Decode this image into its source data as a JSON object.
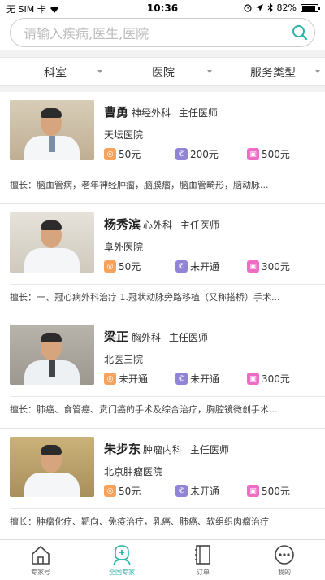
{
  "status_bar": {
    "carrier": "无 SIM 卡",
    "time": "10:36",
    "battery": "82%"
  },
  "search": {
    "placeholder": "请输入疾病,医生,医院"
  },
  "filters": [
    {
      "label": "科室"
    },
    {
      "label": "医院"
    },
    {
      "label": "服务类型"
    }
  ],
  "doctors": [
    {
      "name": "曹勇",
      "dept": "神经外科",
      "title": "主任医师",
      "hospital": "天坛医院",
      "prices": [
        "50元",
        "200元",
        "500元"
      ],
      "specialty": "擅长：脑血管病，老年神经肿瘤，脑膜瘤，脑血管畸形，脑动脉..."
    },
    {
      "name": "杨秀滨",
      "dept": "心外科",
      "title": "主任医师",
      "hospital": "阜外医院",
      "prices": [
        "50元",
        "未开通",
        "300元"
      ],
      "specialty": "擅长：一、冠心病外科治疗 1.冠状动脉旁路移植（又称搭桥）手术..."
    },
    {
      "name": "梁正",
      "dept": "胸外科",
      "title": "主任医师",
      "hospital": "北医三院",
      "prices": [
        "未开通",
        "未开通",
        "300元"
      ],
      "specialty": "擅长：肺癌、食管癌、贲门癌的手术及综合治疗，胸腔镜微创手术..."
    },
    {
      "name": "朱步东",
      "dept": "肿瘤内科",
      "title": "主任医师",
      "hospital": "北京肿瘤医院",
      "prices": [
        "50元",
        "未开通",
        "500元"
      ],
      "specialty": "擅长：肿瘤化疗、靶向、免疫治疗，乳癌、肺癌、软组织肉瘤治疗"
    }
  ],
  "tabs": [
    {
      "label": "专家号",
      "icon": "home-icon"
    },
    {
      "label": "全国专家",
      "icon": "doctor-icon"
    },
    {
      "label": "订单",
      "icon": "notebook-icon"
    },
    {
      "label": "我的",
      "icon": "more-icon"
    }
  ],
  "colors": {
    "accent": "#2bb3a6",
    "orange": "#f7a35c",
    "purple": "#8f84d6",
    "pink": "#ee6cc4"
  }
}
